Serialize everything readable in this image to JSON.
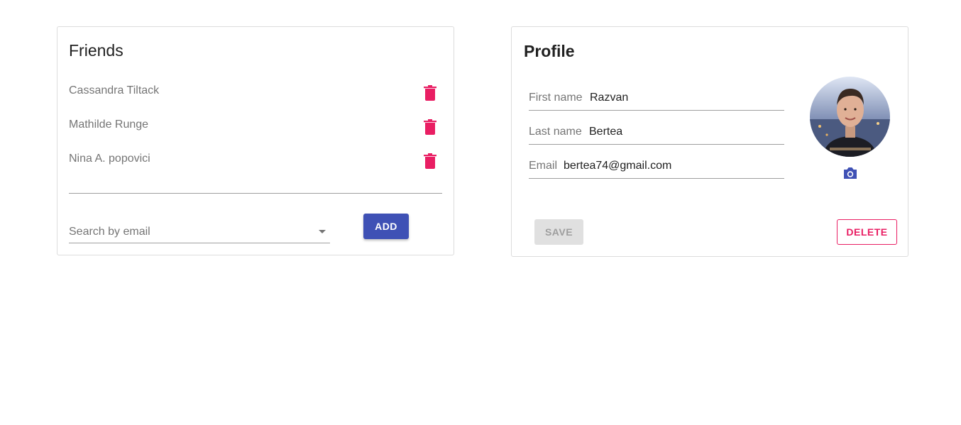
{
  "friends": {
    "title": "Friends",
    "items": [
      {
        "name": "Cassandra Tiltack",
        "delete_icon": "trash-icon"
      },
      {
        "name": "Mathilde Runge",
        "delete_icon": "trash-icon"
      },
      {
        "name": "Nina A. popovici",
        "delete_icon": "trash-icon"
      }
    ],
    "search": {
      "placeholder": "Search by email",
      "value": ""
    },
    "add_label": "ADD"
  },
  "profile": {
    "title": "Profile",
    "fields": [
      {
        "label": "First name",
        "value": "Razvan"
      },
      {
        "label": "Last name",
        "value": "Bertea"
      },
      {
        "label": "Email",
        "value": "bertea74@gmail.com"
      }
    ],
    "avatar_icon": "avatar-photo",
    "camera_icon": "camera-icon",
    "save_label": "SAVE",
    "delete_label": "DELETE"
  },
  "colors": {
    "primary": "#3f51b5",
    "accent": "#e91e63",
    "text_secondary": "#757575",
    "disabled_bg": "#e0e0e0"
  }
}
